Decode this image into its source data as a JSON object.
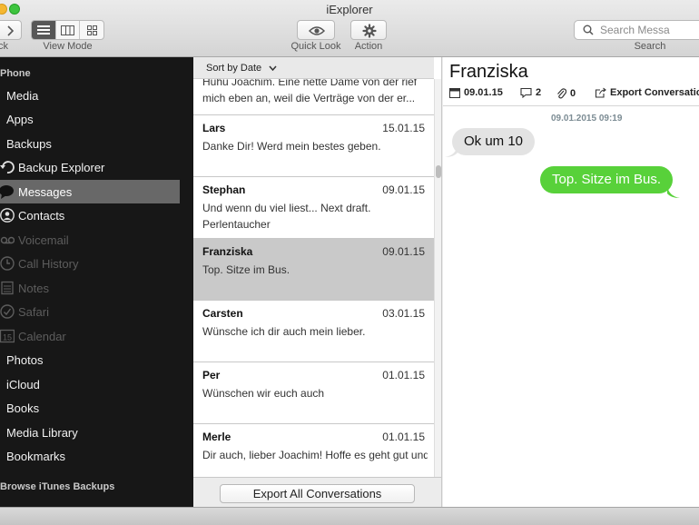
{
  "window": {
    "title": "iExplorer"
  },
  "toolbar": {
    "back_label": "ck",
    "view_mode_label": "View Mode",
    "quick_look_label": "Quick Look",
    "action_label": "Action",
    "search_placeholder": "Search Messa",
    "search_label": "Search"
  },
  "sidebar": {
    "header_device": "Phone",
    "items": [
      {
        "label": "Media",
        "icon": "music-note-icon"
      },
      {
        "label": "Apps",
        "icon": "apps-icon"
      },
      {
        "label": "Backups",
        "icon": "backups-icon"
      },
      {
        "label": "Backup Explorer",
        "icon": "clock-refresh-icon"
      },
      {
        "label": "Messages",
        "icon": "speech-bubble-icon"
      },
      {
        "label": "Contacts",
        "icon": "contact-icon"
      },
      {
        "label": "Voicemail",
        "icon": "voicemail-icon"
      },
      {
        "label": "Call History",
        "icon": "clock-icon"
      },
      {
        "label": "Notes",
        "icon": "notes-icon"
      },
      {
        "label": "Safari",
        "icon": "compass-icon"
      },
      {
        "label": "Calendar",
        "icon": "calendar-icon",
        "badge": "15"
      },
      {
        "label": "Photos",
        "icon": "photos-icon"
      },
      {
        "label": "iCloud",
        "icon": "cloud-icon"
      },
      {
        "label": "Books",
        "icon": "book-icon"
      },
      {
        "label": "Media Library",
        "icon": "library-icon"
      },
      {
        "label": "Bookmarks",
        "icon": "bookmark-icon"
      }
    ],
    "header_itunes": "Browse iTunes Backups"
  },
  "list": {
    "sort_label": "Sort by Date",
    "partial_preview": "Huhu Joachim. Eine nette Dame von der rief mich eben an, weil die Verträge von der er...",
    "rows": [
      {
        "name": "Lars",
        "date": "15.01.15",
        "preview": "Danke Dir! Werd mein bestes geben."
      },
      {
        "name": "Stephan",
        "date": "09.01.15",
        "preview": "Und wenn du viel liest... Next draft. Perlentaucher"
      },
      {
        "name": "Franziska",
        "date": "09.01.15",
        "preview": "Top. Sitze im Bus."
      },
      {
        "name": "Carsten",
        "date": "03.01.15",
        "preview": "Wünsche ich dir auch mein lieber."
      },
      {
        "name": "Per",
        "date": "01.01.15",
        "preview": "Wünschen wir euch auch"
      },
      {
        "name": "Merle",
        "date": "01.01.15",
        "preview": "Dir auch, lieber Joachim! Hoffe es geht gut und"
      }
    ],
    "export_all_label": "Export All Conversations"
  },
  "conversation": {
    "title": "Franziska",
    "date": "09.01.15",
    "message_count": "2",
    "attachment_count": "0",
    "export_label": "Export Conversation",
    "timestamp": "09.01.2015 09:19",
    "messages": [
      {
        "direction": "incoming",
        "text": "Ok um 10"
      },
      {
        "direction": "outgoing",
        "text": "Top. Sitze im Bus."
      }
    ]
  },
  "colors": {
    "sidebar_bg": "#171717",
    "sidebar_selected": "#686868",
    "incoming_bubble": "#e3e3e3",
    "outgoing_bubble": "#58d13a",
    "selected_row": "#c9c9c9"
  }
}
